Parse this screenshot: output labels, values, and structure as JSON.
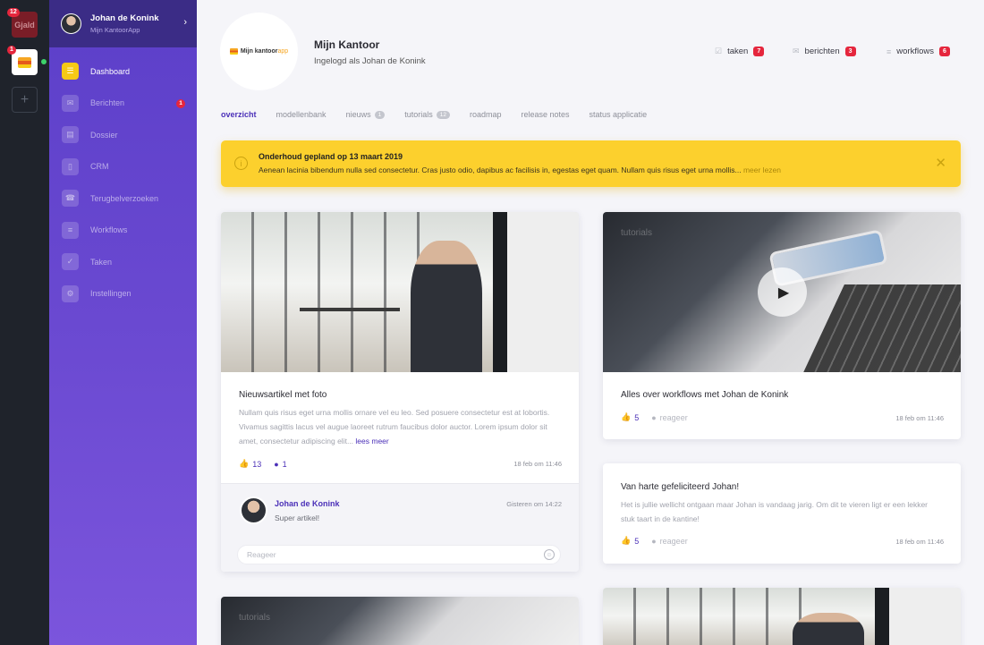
{
  "rail": {
    "apps": [
      {
        "name": "Gjald",
        "badge": "12"
      },
      {
        "name": "Mijn KantoorApp",
        "badge": "1"
      }
    ],
    "add_label": "+"
  },
  "sidebar": {
    "profile": {
      "name": "Johan de Konink",
      "app": "Mijn KantoorApp"
    },
    "items": [
      {
        "label": "Dashboard",
        "icon": "dashboard-icon",
        "active": true
      },
      {
        "label": "Berichten",
        "icon": "messages-icon",
        "badge": "1"
      },
      {
        "label": "Dossier",
        "icon": "folder-icon"
      },
      {
        "label": "CRM",
        "icon": "contacts-icon"
      },
      {
        "label": "Terugbelverzoeken",
        "icon": "phone-icon"
      },
      {
        "label": "Workflows",
        "icon": "list-icon"
      },
      {
        "label": "Taken",
        "icon": "checkbox-icon"
      },
      {
        "label": "Instellingen",
        "icon": "gear-icon"
      }
    ]
  },
  "header": {
    "logo_text": "Mijn kantoor",
    "logo_suffix": "app",
    "title": "Mijn Kantoor",
    "subtitle": "Ingelogd als Johan de Konink",
    "counters": [
      {
        "label": "taken",
        "count": "7",
        "icon": "checkbox-icon"
      },
      {
        "label": "berichten",
        "count": "3",
        "icon": "messages-icon"
      },
      {
        "label": "workflows",
        "count": "6",
        "icon": "list-icon"
      }
    ]
  },
  "tabs": [
    {
      "label": "overzicht",
      "active": true
    },
    {
      "label": "modellenbank"
    },
    {
      "label": "nieuws",
      "badge": "1"
    },
    {
      "label": "tutorials",
      "badge": "12"
    },
    {
      "label": "roadmap"
    },
    {
      "label": "release notes"
    },
    {
      "label": "status applicatie"
    }
  ],
  "banner": {
    "title": "Onderhoud gepland op 13 maart 2019",
    "text": "Aenean lacinia bibendum nulla sed consectetur. Cras justo odio, dapibus ac facilisis in, egestas eget quam. Nullam quis risus eget urna mollis...",
    "link": "meer lezen",
    "color": "#fcd02d"
  },
  "cards": {
    "news": {
      "title": "Nieuwsartikel met foto",
      "body": "Nullam quis risus eget urna mollis ornare vel eu leo. Sed posuere consectetur est at lobortis. Vivamus sagittis lacus vel augue laoreet rutrum faucibus dolor auctor. Lorem ipsum dolor sit amet, consectetur adipiscing elit...",
      "more": "lees meer",
      "likes": "13",
      "comments": "1",
      "date": "18 feb om 11:46",
      "comment": {
        "author": "Johan de Konink",
        "text": "Super artikel!",
        "date": "Gisteren om 14:22"
      },
      "reply_placeholder": "Reageer"
    },
    "tutorial": {
      "label": "tutorials",
      "title": "Alles over workflows met Johan de Konink",
      "likes": "5",
      "reply": "reageer",
      "date": "18 feb om 11:46"
    },
    "congrats": {
      "title": "Van harte gefeliciteerd Johan!",
      "body": "Het is jullie wellicht ontgaan maar Johan is vandaag jarig. Om dit te vieren ligt er een lekker stuk taart in de kantine!",
      "likes": "5",
      "reply": "reageer",
      "date": "18 feb om 11:46"
    },
    "tutorial2": {
      "label": "tutorials"
    }
  },
  "colors": {
    "accent": "#4b30b8",
    "badge": "#e5263d",
    "sidebar": "#6a49d1"
  }
}
